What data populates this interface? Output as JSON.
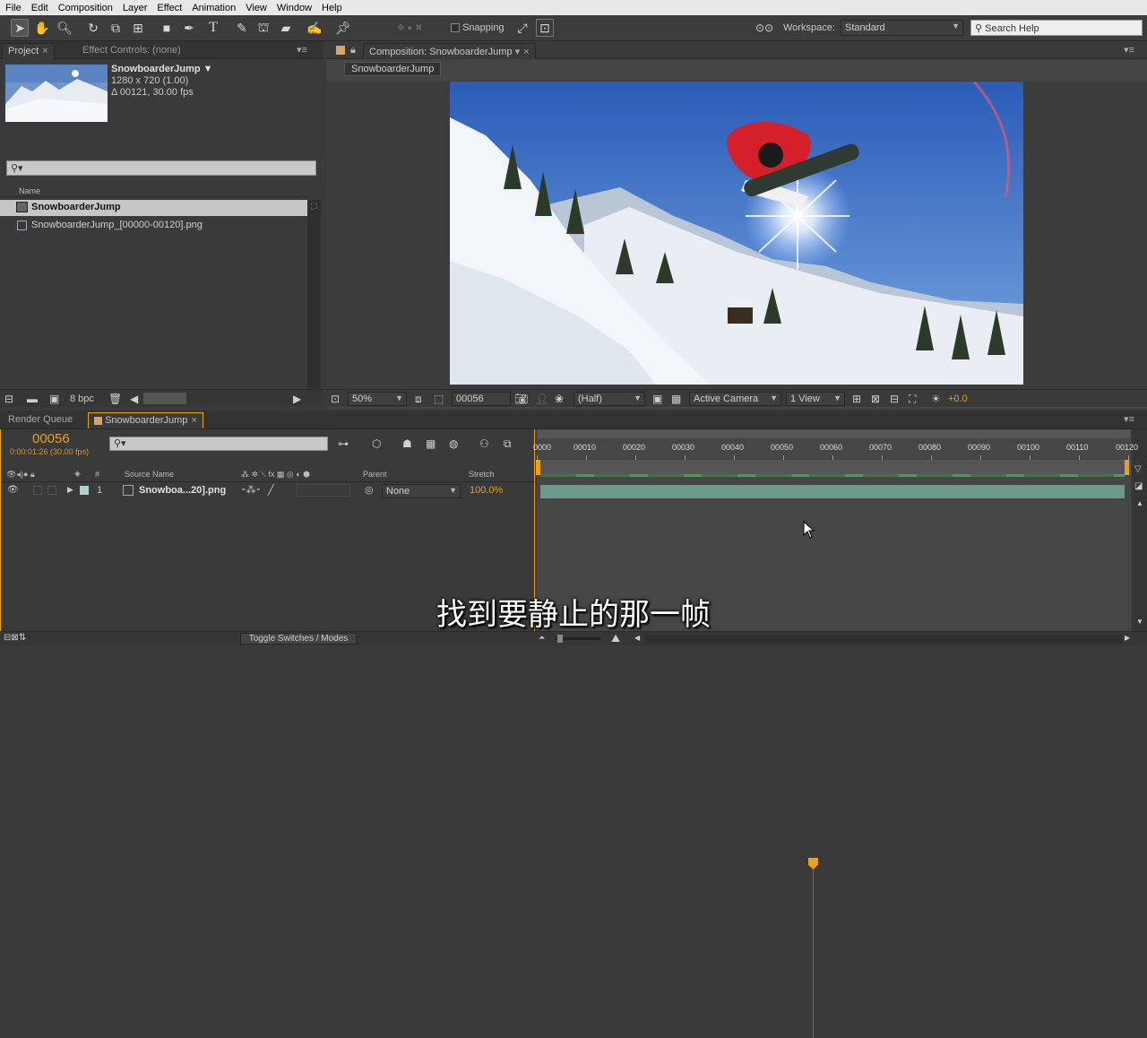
{
  "menu": [
    "File",
    "Edit",
    "Composition",
    "Layer",
    "Effect",
    "Animation",
    "View",
    "Window",
    "Help"
  ],
  "toolbar": {
    "snapping_label": "Snapping",
    "workspace_label": "Workspace:",
    "workspace_value": "Standard",
    "search_placeholder": "Search Help"
  },
  "project": {
    "tab_label": "Project",
    "effect_controls_label": "Effect Controls: (none)",
    "item_name": "SnowboarderJump ▼",
    "item_dims": "1280 x 720 (1.00)",
    "item_duration": "Δ 00121, 30.00 fps",
    "search_value": "",
    "name_header": "Name",
    "items": [
      "SnowboarderJump",
      "SnowboarderJump_[00000-00120].png"
    ],
    "bpc_label": "8 bpc"
  },
  "composition": {
    "tab_label": "Composition: SnowboarderJump",
    "breadcrumb": "SnowboarderJump",
    "zoom": "50%",
    "timecode": "00056",
    "resolution": "(Half)",
    "camera": "Active Camera",
    "view": "1 View",
    "exposure": "+0.0"
  },
  "timeline": {
    "render_queue_label": "Render Queue",
    "comp_tab_label": "SnowboarderJump",
    "current_frame": "00056",
    "current_time": "0:00:01:26 (30.00 fps)",
    "col_source_name": "Source Name",
    "col_parent": "Parent",
    "col_stretch": "Stretch",
    "col_number": "#",
    "layer_number": "1",
    "layer_name": "Snowboa...20].png",
    "parent_value": "None",
    "stretch_value": "100.0%",
    "ruler_labels": [
      "0000",
      "00010",
      "00020",
      "00030",
      "00040",
      "00050",
      "00060",
      "00070",
      "00080",
      "00090",
      "00100",
      "00110",
      "00120"
    ],
    "toggle_label": "Toggle Switches / Modes",
    "playhead_frame": 56,
    "total_frames": 120
  },
  "subtitle": "找到要静止的那一帧",
  "colors": {
    "accent": "#e8a317",
    "playhead": "#d9402a",
    "layer_bar": "#6b9a8c"
  }
}
